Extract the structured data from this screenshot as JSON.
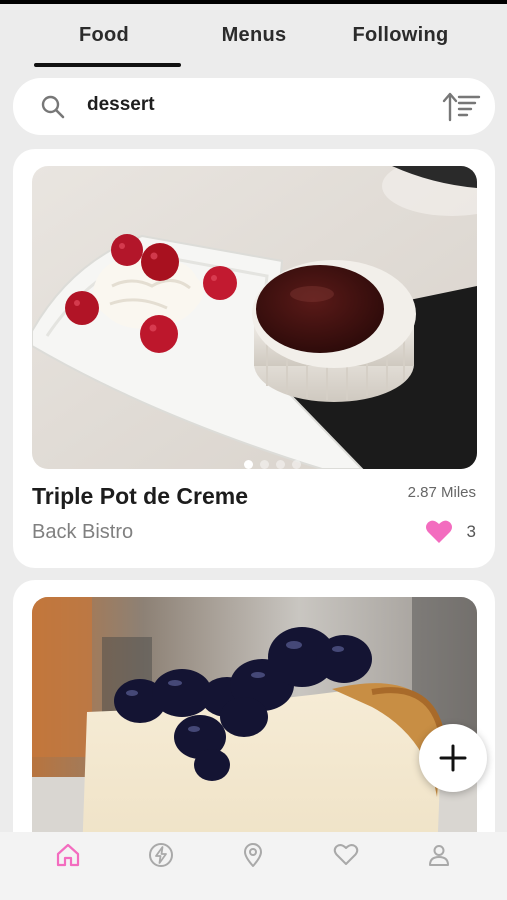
{
  "tabs": [
    {
      "label": "Food",
      "active": true
    },
    {
      "label": "Menus",
      "active": false
    },
    {
      "label": "Following",
      "active": false
    }
  ],
  "search": {
    "value": "dessert",
    "icon": "search-icon",
    "sort_icon": "sort-icon"
  },
  "posts": [
    {
      "title": "Triple Pot de Creme",
      "distance": "2.87 Miles",
      "restaurant": "Back Bistro",
      "likes": "3",
      "liked": true,
      "image": "chocolate pot de creme with raspberries and whipped cream",
      "carousel_total": 4,
      "carousel_active": 1
    },
    {
      "image": "blueberry-topped cheesecake slice"
    }
  ],
  "fab": {
    "icon": "plus-icon"
  },
  "bottom_nav": [
    {
      "icon": "home-icon",
      "active": true
    },
    {
      "icon": "bolt-icon",
      "active": false
    },
    {
      "icon": "location-pin-icon",
      "active": false
    },
    {
      "icon": "heart-icon",
      "active": false
    },
    {
      "icon": "profile-icon",
      "active": false
    }
  ],
  "colors": {
    "accent": "#f36cbf",
    "background": "#ececec",
    "card": "#ffffff",
    "text": "#1f1f1f",
    "muted": "#808080"
  }
}
